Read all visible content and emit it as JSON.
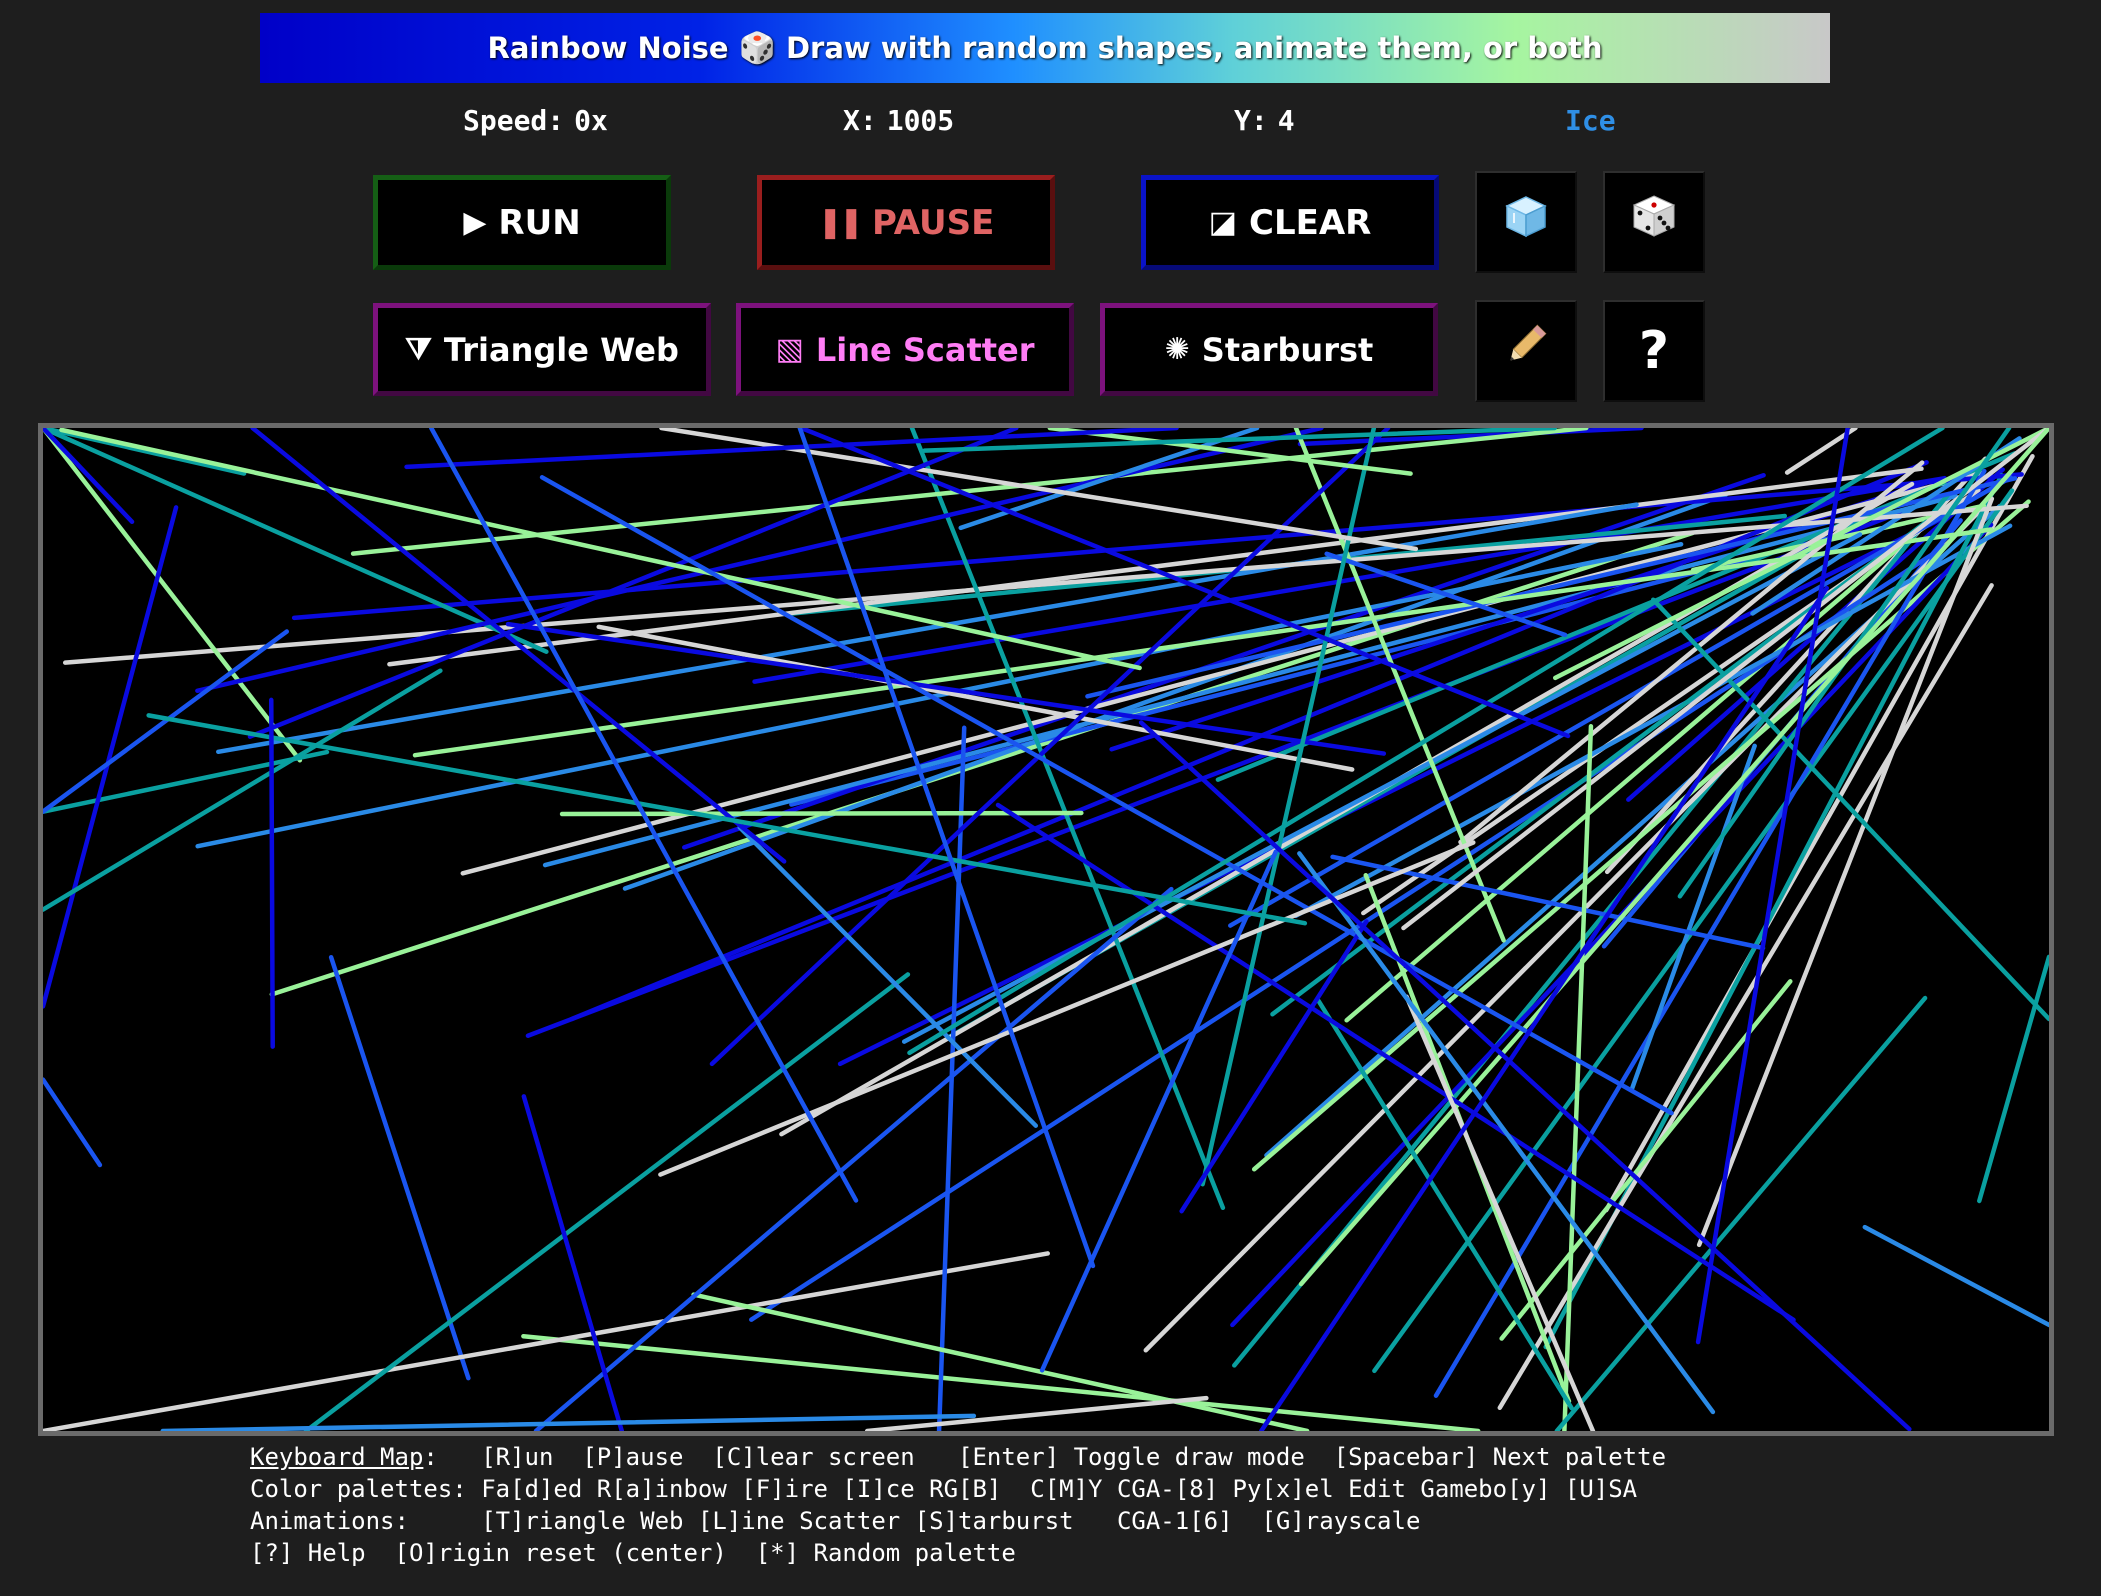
{
  "banner": {
    "title_left": "Rainbow Noise",
    "dice_glyph": "🎲",
    "title_right": "Draw with random shapes, animate them, or both"
  },
  "stats": {
    "speed_label": "Speed:",
    "speed_value": "0x",
    "x_label": "X:",
    "x_value": "1005",
    "y_label": "Y:",
    "y_value": "4",
    "palette_name": "Ice",
    "palette_color": "#2f8fe6"
  },
  "buttons": {
    "run": {
      "icon": "play-icon",
      "glyph": "▶",
      "label": "RUN"
    },
    "pause": {
      "icon": "pause-icon",
      "glyph": "❚❚",
      "label": "PAUSE"
    },
    "clear": {
      "icon": "contrast-icon",
      "glyph": "◪",
      "label": "CLEAR"
    },
    "palette": {
      "icon": "ice-cube-icon"
    },
    "random": {
      "icon": "dice-icon"
    },
    "triangle_web": {
      "icon": "triangle-web-icon",
      "glyph": "⧩",
      "label": "Triangle Web"
    },
    "line_scatter": {
      "icon": "hatched-square-icon",
      "glyph": "▧",
      "label": "Line Scatter"
    },
    "starburst": {
      "icon": "starburst-icon",
      "glyph": "✺",
      "label": "Starburst"
    },
    "draw_mode": {
      "icon": "pencil-icon"
    },
    "help": {
      "icon": "question-icon",
      "glyph": "?"
    }
  },
  "colors": {
    "ice_palette": [
      "#0a0ae0",
      "#1a55f0",
      "#2a8ae6",
      "#0aa0a0",
      "#99f299",
      "#d6d6d6"
    ]
  },
  "help": {
    "keyboard_map_label": "Keyboard Map",
    "line1_rest": ":   [R]un  [P]ause  [C]lear screen   [Enter] Toggle draw mode  [Spacebar] Next palette",
    "line2": "Color palettes: Fa[d]ed R[a]inbow [F]ire [I]ce RG[B]  C[M]Y CGA-[8] Py[x]el Edit Gamebo[y] [U]SA",
    "line3": "Animations:     [T]riangle Web [L]ine Scatter [S]tarburst   CGA-1[6]  [G]rayscale",
    "line4": "[?] Help  [O]rigin reset (center)  [*] Random palette"
  }
}
